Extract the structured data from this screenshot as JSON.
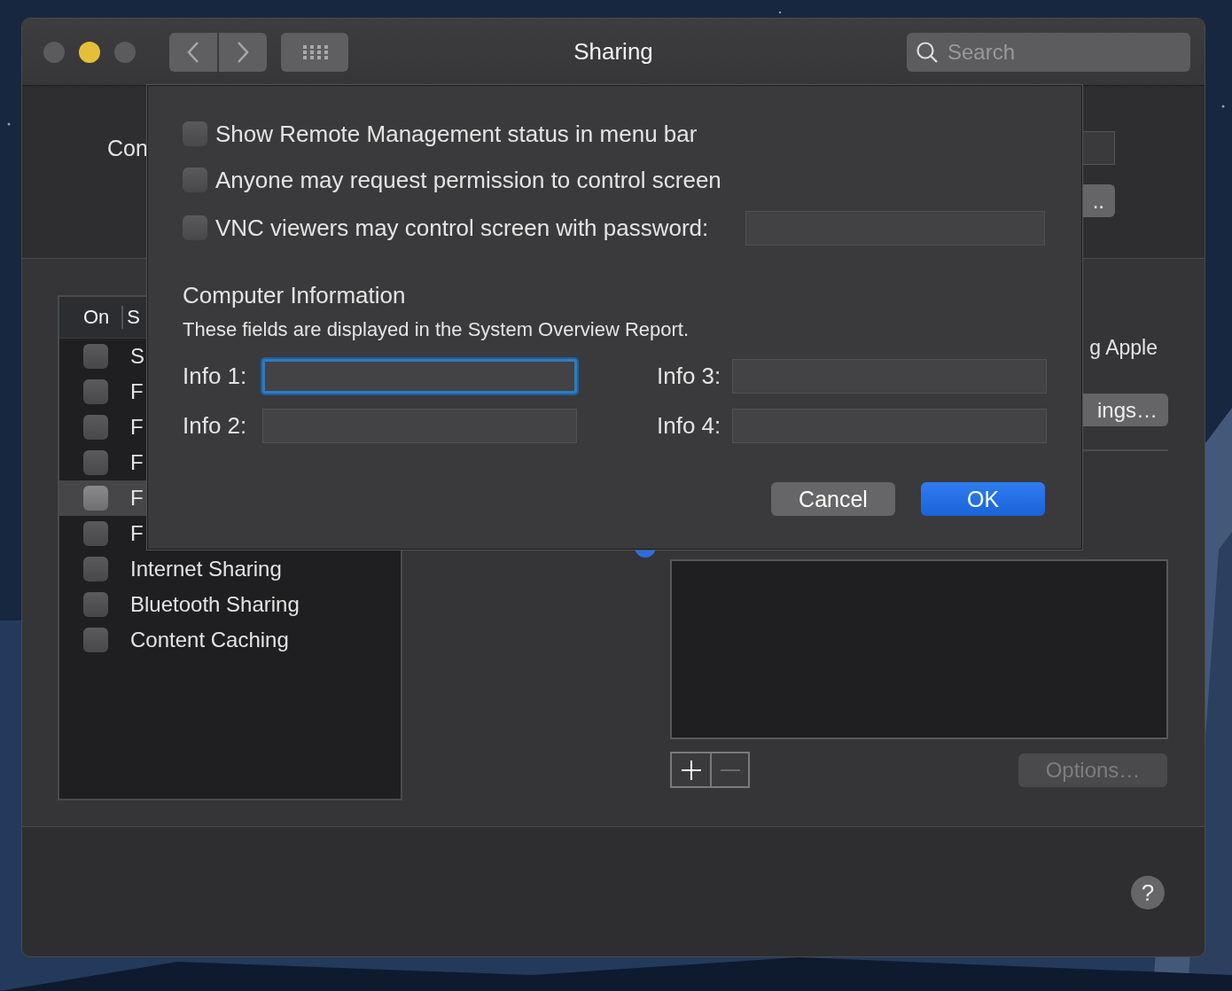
{
  "window": {
    "title": "Sharing",
    "search": {
      "placeholder": "Search"
    }
  },
  "top": {
    "name_label": "Con",
    "edit_button": ".."
  },
  "services": {
    "header": [
      "On",
      "S"
    ],
    "items": [
      {
        "label": "S",
        "checked": false,
        "selected": false
      },
      {
        "label": "F",
        "checked": false,
        "selected": false
      },
      {
        "label": "F",
        "checked": false,
        "selected": false
      },
      {
        "label": "F",
        "checked": false,
        "selected": false
      },
      {
        "label": "F",
        "checked": false,
        "selected": true
      },
      {
        "label": "F",
        "checked": false,
        "selected": false
      },
      {
        "label": "Internet Sharing",
        "checked": false,
        "selected": false
      },
      {
        "label": "Bluetooth Sharing",
        "checked": false,
        "selected": false
      },
      {
        "label": "Content Caching",
        "checked": false,
        "selected": false
      }
    ]
  },
  "detail": {
    "description": "g Apple",
    "settings_button": "ings…",
    "access_radio": {
      "selected": true
    },
    "options_button": {
      "label": "Options…",
      "disabled": true
    },
    "help": "?"
  },
  "sheet": {
    "options": [
      {
        "label": "Show Remote Management status in menu bar",
        "checked": false
      },
      {
        "label": "Anyone may request permission to control screen",
        "checked": false
      },
      {
        "label": "VNC viewers may control screen with password:",
        "checked": false
      }
    ],
    "heading": "Computer Information",
    "note": "These fields are displayed in the System Overview Report.",
    "info": [
      {
        "label": "Info 1:",
        "focused": true
      },
      {
        "label": "Info 2:",
        "focused": false
      },
      {
        "label": "Info 3:",
        "focused": false
      },
      {
        "label": "Info 4:",
        "focused": false
      }
    ],
    "buttons": [
      {
        "label": "Cancel",
        "default": false
      },
      {
        "label": "OK",
        "default": true
      }
    ]
  }
}
